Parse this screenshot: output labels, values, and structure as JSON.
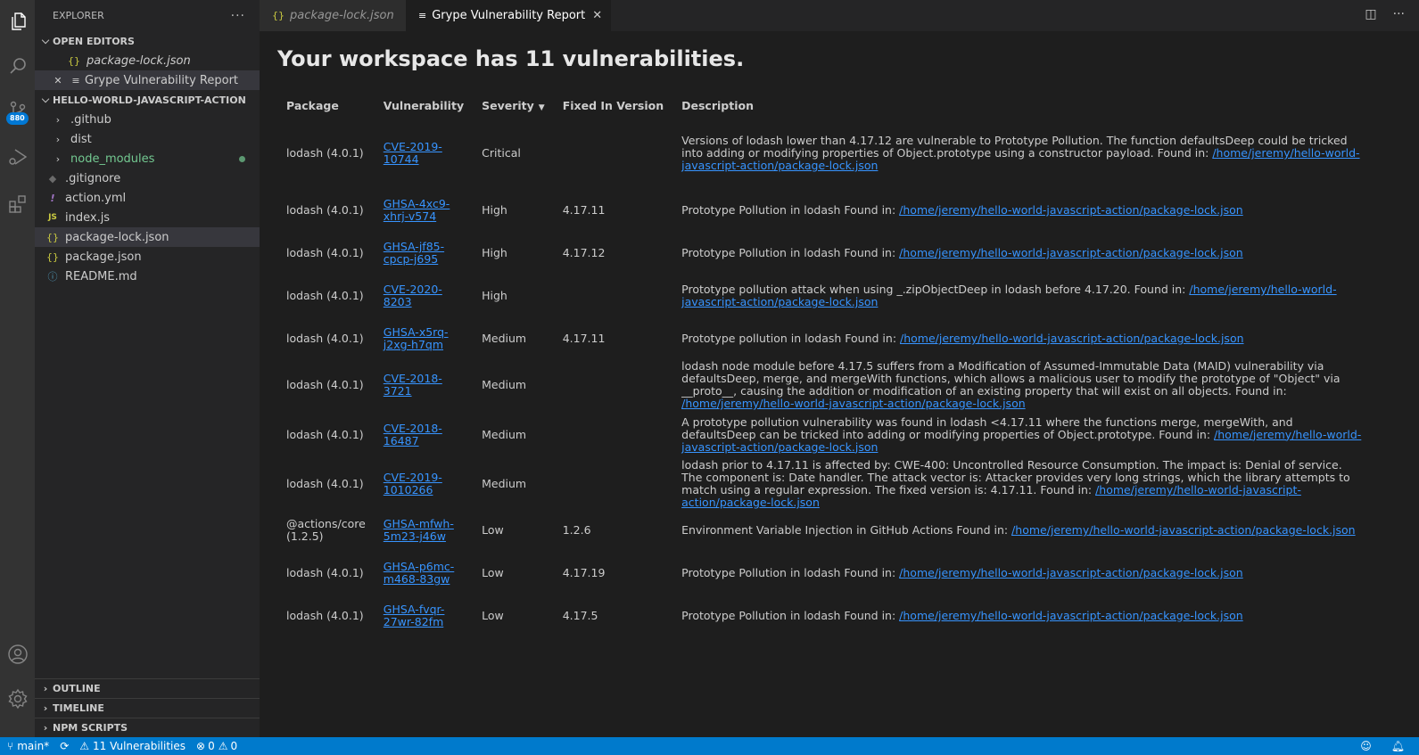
{
  "activity_bar": {
    "items": [
      {
        "name": "explorer",
        "icon": "files-icon"
      },
      {
        "name": "search",
        "icon": "search-icon"
      },
      {
        "name": "source-control",
        "icon": "source-control-icon",
        "badge": "880"
      },
      {
        "name": "run-debug",
        "icon": "run-debug-icon"
      },
      {
        "name": "extensions",
        "icon": "extensions-icon"
      }
    ],
    "bottom": [
      {
        "name": "accounts",
        "icon": "account-icon"
      },
      {
        "name": "manage",
        "icon": "gear-icon"
      }
    ]
  },
  "sidebar": {
    "title": "EXPLORER",
    "more": "···",
    "open_editors": {
      "label": "OPEN EDITORS",
      "items": [
        {
          "label": "package-lock.json",
          "icon": "{}",
          "italic": true
        },
        {
          "label": "Grype Vulnerability Report",
          "icon": "≡",
          "close": "✕",
          "active": true
        }
      ]
    },
    "project": {
      "label": "HELLO-WORLD-JAVASCRIPT-ACTION",
      "items": [
        {
          "label": ".github",
          "type": "folder"
        },
        {
          "label": "dist",
          "type": "folder"
        },
        {
          "label": "node_modules",
          "type": "folder",
          "modified": true
        },
        {
          "label": ".gitignore",
          "icon": "◆"
        },
        {
          "label": "action.yml",
          "icon": "!"
        },
        {
          "label": "index.js",
          "icon": "JS"
        },
        {
          "label": "package-lock.json",
          "icon": "{}",
          "active": true
        },
        {
          "label": "package.json",
          "icon": "{}"
        },
        {
          "label": "README.md",
          "icon": "ⓘ"
        }
      ]
    },
    "bottom_sections": [
      "OUTLINE",
      "TIMELINE",
      "NPM SCRIPTS"
    ]
  },
  "tabs": [
    {
      "label": "package-lock.json",
      "icon": "{}",
      "active": false
    },
    {
      "label": "Grype Vulnerability Report",
      "icon": "≡",
      "active": true,
      "close": "✕"
    }
  ],
  "tab_actions": {
    "split": "◫",
    "more": "···"
  },
  "report": {
    "title": "Your workspace has 11 vulnerabilities.",
    "columns": [
      "Package",
      "Vulnerability",
      "Severity",
      "Fixed In Version",
      "Description"
    ],
    "sort_indicator": "▼",
    "rows": [
      {
        "package": "lodash (4.0.1)",
        "vuln": "CVE-2019-10744",
        "severity": "Critical",
        "fixed": "",
        "desc": "Versions of lodash lower than 4.17.12 are vulnerable to Prototype Pollution. The function defaultsDeep could be tricked into adding or modifying properties of Object.prototype using a constructor payload. Found in: ",
        "path": "/home/jeremy/hello-world-javascript-action/package-lock.json"
      },
      {
        "package": "lodash (4.0.1)",
        "vuln": "GHSA-4xc9-xhrj-v574",
        "severity": "High",
        "fixed": "4.17.11",
        "desc": "Prototype Pollution in lodash Found in: ",
        "path": "/home/jeremy/hello-world-javascript-action/package-lock.json"
      },
      {
        "package": "lodash (4.0.1)",
        "vuln": "GHSA-jf85-cpcp-j695",
        "severity": "High",
        "fixed": "4.17.12",
        "desc": "Prototype Pollution in lodash Found in: ",
        "path": "/home/jeremy/hello-world-javascript-action/package-lock.json"
      },
      {
        "package": "lodash (4.0.1)",
        "vuln": "CVE-2020-8203",
        "severity": "High",
        "fixed": "",
        "desc": "Prototype pollution attack when using _.zipObjectDeep in lodash before 4.17.20. Found in: ",
        "path": "/home/jeremy/hello-world-javascript-action/package-lock.json"
      },
      {
        "package": "lodash (4.0.1)",
        "vuln": "GHSA-x5rq-j2xg-h7qm",
        "severity": "Medium",
        "fixed": "4.17.11",
        "desc": "Prototype pollution in lodash Found in: ",
        "path": "/home/jeremy/hello-world-javascript-action/package-lock.json"
      },
      {
        "package": "lodash (4.0.1)",
        "vuln": "CVE-2018-3721",
        "severity": "Medium",
        "fixed": "",
        "desc": "lodash node module before 4.17.5 suffers from a Modification of Assumed-Immutable Data (MAID) vulnerability via defaultsDeep, merge, and mergeWith functions, which allows a malicious user to modify the prototype of \"Object\" via __proto__, causing the addition or modification of an existing property that will exist on all objects. Found in: ",
        "path": "/home/jeremy/hello-world-javascript-action/package-lock.json"
      },
      {
        "package": "lodash (4.0.1)",
        "vuln": "CVE-2018-16487",
        "severity": "Medium",
        "fixed": "",
        "desc": "A prototype pollution vulnerability was found in lodash <4.17.11 where the functions merge, mergeWith, and defaultsDeep can be tricked into adding or modifying properties of Object.prototype. Found in: ",
        "path": "/home/jeremy/hello-world-javascript-action/package-lock.json"
      },
      {
        "package": "lodash (4.0.1)",
        "vuln": "CVE-2019-1010266",
        "severity": "Medium",
        "fixed": "",
        "desc": "lodash prior to 4.17.11 is affected by: CWE-400: Uncontrolled Resource Consumption. The impact is: Denial of service. The component is: Date handler. The attack vector is: Attacker provides very long strings, which the library attempts to match using a regular expression. The fixed version is: 4.17.11. Found in: ",
        "path": "/home/jeremy/hello-world-javascript-action/package-lock.json"
      },
      {
        "package": "@actions/core (1.2.5)",
        "vuln": "GHSA-mfwh-5m23-j46w",
        "severity": "Low",
        "fixed": "1.2.6",
        "desc": "Environment Variable Injection in GitHub Actions Found in: ",
        "path": "/home/jeremy/hello-world-javascript-action/package-lock.json"
      },
      {
        "package": "lodash (4.0.1)",
        "vuln": "GHSA-p6mc-m468-83gw",
        "severity": "Low",
        "fixed": "4.17.19",
        "desc": "Prototype Pollution in lodash Found in: ",
        "path": "/home/jeremy/hello-world-javascript-action/package-lock.json"
      },
      {
        "package": "lodash (4.0.1)",
        "vuln": "GHSA-fvqr-27wr-82fm",
        "severity": "Low",
        "fixed": "4.17.5",
        "desc": "Prototype Pollution in lodash Found in: ",
        "path": "/home/jeremy/hello-world-javascript-action/package-lock.json"
      }
    ]
  },
  "severity_colors": {
    "Critical": "#f14c4c",
    "High": "#e3573d",
    "Medium": "#e88c3c",
    "Low": "#d7a04a"
  },
  "statusbar": {
    "branch": "main*",
    "sync": "⟳",
    "vulnerabilities": "11 Vulnerabilities",
    "errors": "0",
    "warnings": "0",
    "bg_color": "#007acc"
  }
}
